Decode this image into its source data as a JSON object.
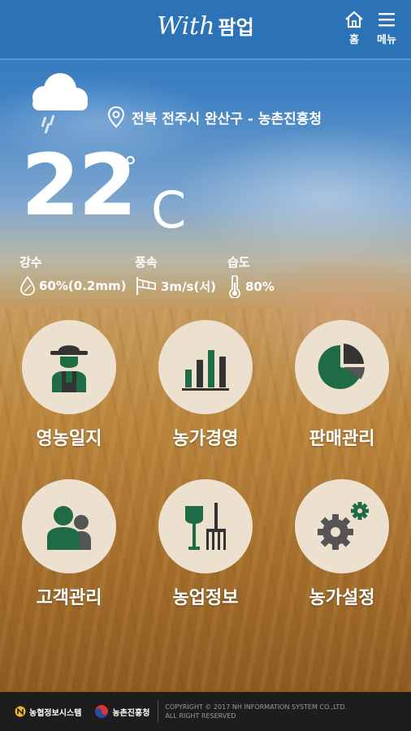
{
  "header": {
    "logo_script": "With",
    "logo_word": "팜업",
    "home_label": "홈",
    "menu_label": "메뉴"
  },
  "weather": {
    "location": "전북 전주시 완산구 - 농촌진흥청",
    "temperature": "22",
    "degree_symbol": "°",
    "unit": "C",
    "precip_title": "강수",
    "precip_value": "60%(0.2mm)",
    "wind_title": "풍속",
    "wind_value": "3m/s(서)",
    "humidity_title": "습도",
    "humidity_value": "80%"
  },
  "menu": [
    {
      "label": "영농일지",
      "icon": "farmer-icon"
    },
    {
      "label": "농가경영",
      "icon": "bar-chart-icon"
    },
    {
      "label": "판매관리",
      "icon": "pie-chart-icon"
    },
    {
      "label": "고객관리",
      "icon": "customers-icon"
    },
    {
      "label": "농업정보",
      "icon": "shovel-rake-icon"
    },
    {
      "label": "농가설정",
      "icon": "gears-icon"
    }
  ],
  "footer": {
    "org1": "농협정보시스템",
    "org2": "농촌진흥청",
    "copyright_line1": "COPYRIGHT © 2017 NH INFORMATION SYSTEM CO.,LTD.",
    "copyright_line2": "ALL RIGHT RESERVED"
  },
  "colors": {
    "header_bg": "#2b73b6",
    "tile_bg": "#ece0cf",
    "icon_green": "#1f6b45",
    "icon_dark": "#333333",
    "footer_bg": "#1d1d1d"
  }
}
